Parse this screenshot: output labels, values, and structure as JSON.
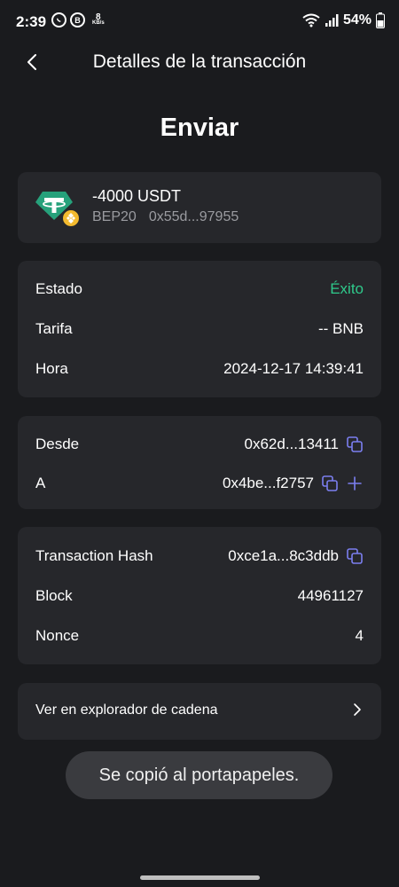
{
  "status_bar": {
    "time": "2:39",
    "speed_value": "8",
    "speed_unit": "KB/s",
    "battery": "54%",
    "b_badge": "B"
  },
  "header": {
    "title": "Detalles de la transacción"
  },
  "page_title": "Enviar",
  "token": {
    "amount": "-4000 USDT",
    "network": "BEP20",
    "address": "0x55d...97955"
  },
  "details": {
    "status_label": "Estado",
    "status_value": "Éxito",
    "fee_label": "Tarifa",
    "fee_value": "-- BNB",
    "time_label": "Hora",
    "time_value": "2024-12-17 14:39:41"
  },
  "addresses": {
    "from_label": "Desde",
    "from_value": "0x62d...13411",
    "to_label": "A",
    "to_value": "0x4be...f2757"
  },
  "chain": {
    "hash_label": "Transaction Hash",
    "hash_value": "0xce1a...8c3ddb",
    "block_label": "Block",
    "block_value": "44961127",
    "nonce_label": "Nonce",
    "nonce_value": "4"
  },
  "explorer": {
    "label": "Ver en explorador de cadena"
  },
  "toast": {
    "message": "Se copió al portapapeles."
  },
  "colors": {
    "background": "#1a1b1e",
    "card": "#26272b",
    "success": "#2fc98b",
    "accent_icon": "#7b7ff0",
    "tether": "#26a17b",
    "bnb": "#f3ba2f"
  }
}
